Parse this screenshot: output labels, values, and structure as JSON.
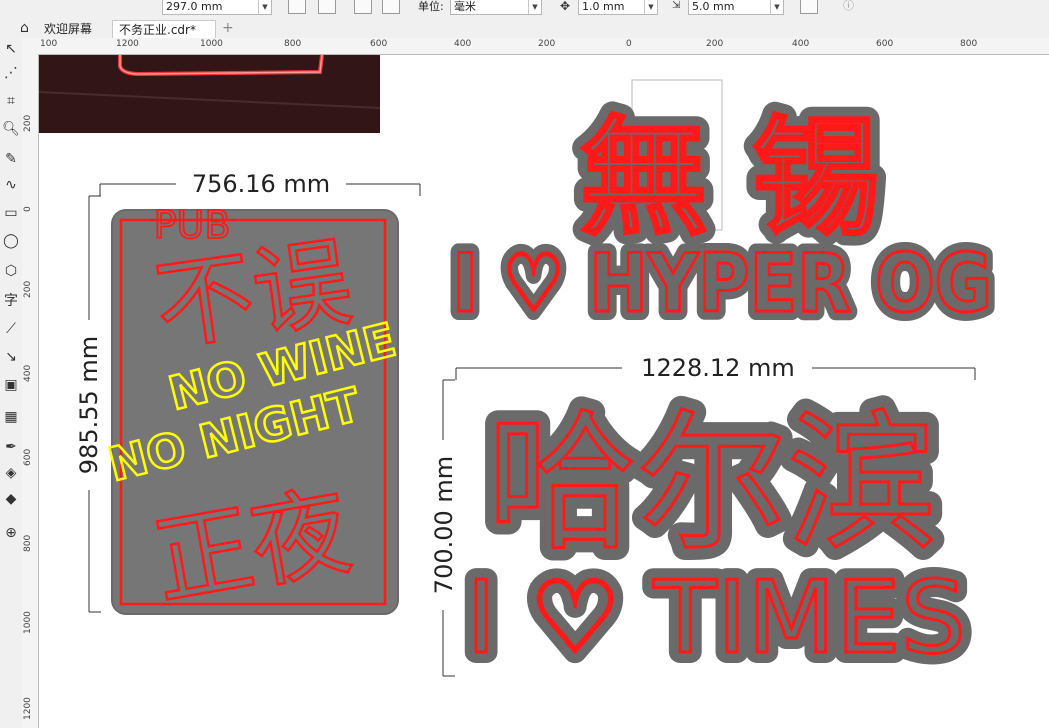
{
  "property_bar": {
    "page_height": "297.0 mm",
    "units_label": "单位:",
    "units_value": "毫米",
    "nudge_value": "1.0 mm",
    "duplicate_value": "5.0 mm"
  },
  "tabs": [
    {
      "label": "欢迎屏幕"
    },
    {
      "label": "不务正业.cdr*"
    }
  ],
  "ruler": {
    "h_labels": [
      "100",
      "1200",
      "1000",
      "800",
      "600",
      "400",
      "200",
      "0",
      "200",
      "400",
      "600",
      "800"
    ],
    "v_labels": [
      "200",
      "0",
      "200",
      "400",
      "600",
      "800",
      "1000",
      "1200"
    ]
  },
  "canvas": {
    "sign_left": {
      "width_dim": "756.16 mm",
      "height_dim": "985.55 mm",
      "pub": "PUB",
      "cn_top": "不误",
      "en_line1": "NO WINE",
      "en_line2": "NO NIGHT",
      "cn_bottom": "正夜"
    },
    "sign_top_right": {
      "cn": "無 锡",
      "en": "I ♡ HYPER OG"
    },
    "sign_bottom_right": {
      "width_dim": "1228.12 mm",
      "height_dim": "700.00 mm",
      "cn": "哈尔滨",
      "en": "I ♡ TIMES"
    }
  },
  "colors": {
    "neon_red": "#ff1a1a",
    "neon_yellow": "#ffff00",
    "board_gray": "#737373",
    "board_border": "#5a5a5a"
  }
}
